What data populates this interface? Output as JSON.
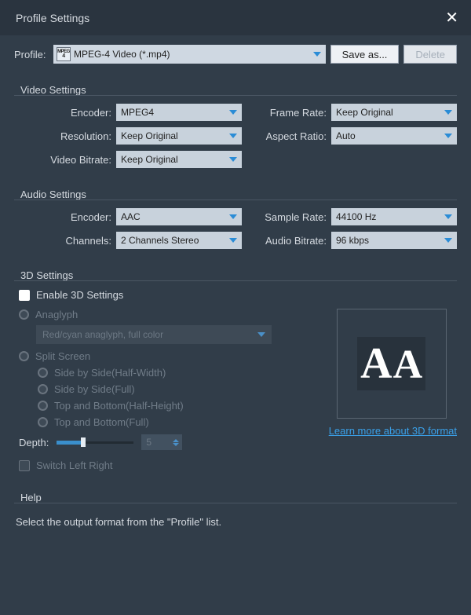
{
  "window": {
    "title": "Profile Settings"
  },
  "profile": {
    "label": "Profile:",
    "value": "MPEG-4 Video (*.mp4)",
    "icon_text": "MPEG4",
    "save_as": "Save as...",
    "delete": "Delete"
  },
  "video": {
    "title": "Video Settings",
    "encoder_label": "Encoder:",
    "encoder_value": "MPEG4",
    "resolution_label": "Resolution:",
    "resolution_value": "Keep Original",
    "bitrate_label": "Video Bitrate:",
    "bitrate_value": "Keep Original",
    "frame_rate_label": "Frame Rate:",
    "frame_rate_value": "Keep Original",
    "aspect_label": "Aspect Ratio:",
    "aspect_value": "Auto"
  },
  "audio": {
    "title": "Audio Settings",
    "encoder_label": "Encoder:",
    "encoder_value": "AAC",
    "channels_label": "Channels:",
    "channels_value": "2 Channels Stereo",
    "sample_rate_label": "Sample Rate:",
    "sample_rate_value": "44100 Hz",
    "bitrate_label": "Audio Bitrate:",
    "bitrate_value": "96 kbps"
  },
  "three_d": {
    "title": "3D Settings",
    "enable_label": "Enable 3D Settings",
    "anaglyph_label": "Anaglyph",
    "anaglyph_value": "Red/cyan anaglyph, full color",
    "split_label": "Split Screen",
    "sbs_half": "Side by Side(Half-Width)",
    "sbs_full": "Side by Side(Full)",
    "tab_half": "Top and Bottom(Half-Height)",
    "tab_full": "Top and Bottom(Full)",
    "depth_label": "Depth:",
    "depth_value": "5",
    "switch_label": "Switch Left Right",
    "learn_more": "Learn more about 3D format",
    "preview_glyph_a": "A",
    "preview_glyph_b": "A"
  },
  "help": {
    "title": "Help",
    "text": "Select the output format from the \"Profile\" list."
  }
}
